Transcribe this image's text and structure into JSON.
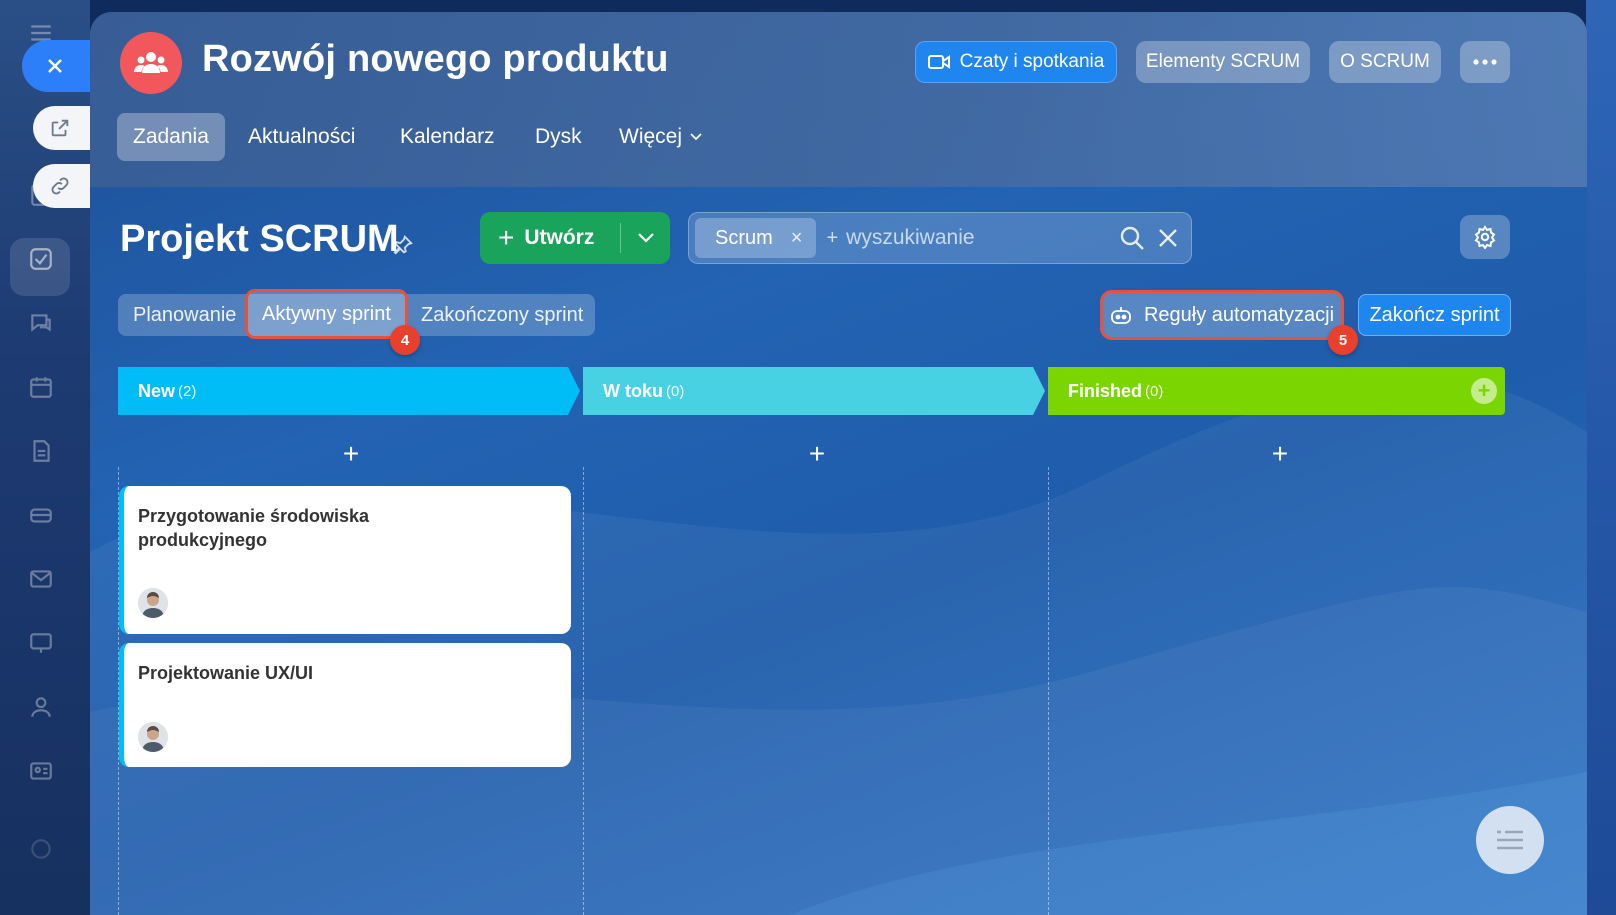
{
  "window": {
    "close_icon": "close-icon"
  },
  "header": {
    "title": "Rozwój nowego produktu",
    "buttons": {
      "chats": "Czaty i spotkania",
      "scrum_elements": "Elementy SCRUM",
      "about_scrum": "O SCRUM",
      "more": "more-icon"
    },
    "tabs": [
      {
        "label": "Zadania",
        "active": true
      },
      {
        "label": "Aktualności"
      },
      {
        "label": "Kalendarz"
      },
      {
        "label": "Dysk"
      },
      {
        "label": "Więcej"
      }
    ]
  },
  "project": {
    "title": "Projekt SCRUM",
    "create_label": "Utwórz",
    "search": {
      "chip": "Scrum",
      "placeholder": "wyszukiwanie",
      "add_prefix": "+"
    }
  },
  "sprint_tabs": [
    {
      "label": "Planowanie"
    },
    {
      "label": "Aktywny sprint",
      "active": true
    },
    {
      "label": "Zakończony sprint"
    }
  ],
  "actions": {
    "automation_rules": "Reguły automatyzacji",
    "finish_sprint": "Zakończ sprint"
  },
  "markers": {
    "active_sprint": "4",
    "automation": "5"
  },
  "columns": [
    {
      "name": "New",
      "count": "(2)",
      "color": "#00bdf7"
    },
    {
      "name": "W toku",
      "count": "(0)",
      "color": "#47d1e2"
    },
    {
      "name": "Finished",
      "count": "(0)",
      "color": "#7bd500"
    }
  ],
  "add_task_label": "+",
  "cards": [
    {
      "title": "Przygotowanie środowiska produkcyjnego"
    },
    {
      "title": "Projektowanie UX/UI"
    }
  ],
  "colors": {
    "accent_blue": "#1f86f0",
    "create_green": "#1aa35a",
    "highlight_red": "#e8402d"
  }
}
